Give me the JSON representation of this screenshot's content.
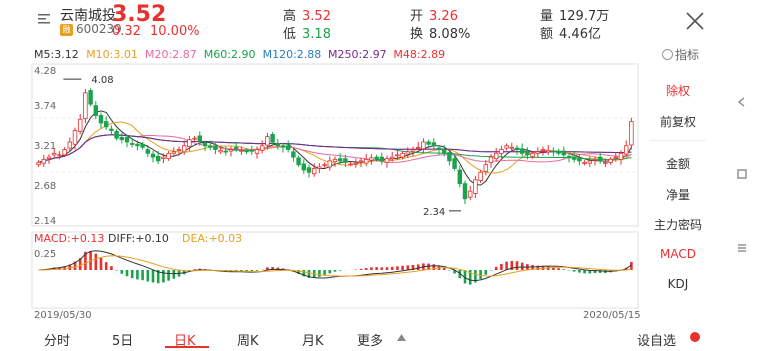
{
  "header": {
    "stock_name": "云南城投",
    "tag": "融",
    "code": "600239",
    "price": "3.52",
    "change": "0.32",
    "change_pct": "10.00%",
    "high_label": "高",
    "high_value": "3.52",
    "low_label": "低",
    "low_value": "3.18",
    "open_label": "开",
    "open_value": "3.26",
    "turnover_label": "换",
    "turnover_value": "8.08%",
    "volume_label": "量",
    "volume_value": "129.7万",
    "amount_label": "额",
    "amount_value": "4.46亿"
  },
  "indicator_link": "指标",
  "ma_legend": [
    {
      "label": "M5:3.12",
      "color": "#333333"
    },
    {
      "label": "M10:3.01",
      "color": "#e8a020"
    },
    {
      "label": "M20:2.87",
      "color": "#e86aa0"
    },
    {
      "label": "M60:2.90",
      "color": "#1aa34a"
    },
    {
      "label": "M120:2.88",
      "color": "#2a7fc0"
    },
    {
      "label": "M250:2.97",
      "color": "#7a2a8a"
    },
    {
      "label": "M48:2.89",
      "color": "#e8312f"
    }
  ],
  "chart_data": {
    "type": "candlestick",
    "y_ticks": [
      "4.28",
      "3.74",
      "3.21",
      "2.68",
      "2.14"
    ],
    "ylim": [
      2.14,
      4.28
    ],
    "annotations": [
      {
        "label": "4.08",
        "value": 4.08
      },
      {
        "label": "2.34",
        "value": 2.34
      }
    ],
    "macd_legend": [
      {
        "label": "MACD:+0.13",
        "color": "#e8312f"
      },
      {
        "label": "DIFF:+0.10",
        "color": "#333333"
      },
      {
        "label": "DEA:+0.03",
        "color": "#e8a020"
      }
    ],
    "macd_tick": "0.25",
    "x_start": "2019/05/30",
    "x_end": "2020/05/15",
    "closes": [
      2.98,
      3.02,
      3.05,
      3.1,
      3.08,
      3.15,
      3.25,
      3.4,
      3.55,
      3.9,
      3.75,
      3.6,
      3.5,
      3.45,
      3.4,
      3.3,
      3.28,
      3.25,
      3.22,
      3.2,
      3.18,
      3.1,
      3.05,
      3.0,
      3.05,
      3.1,
      3.12,
      3.15,
      3.2,
      3.28,
      3.3,
      3.25,
      3.2,
      3.18,
      3.15,
      3.14,
      3.12,
      3.15,
      3.16,
      3.14,
      3.12,
      3.13,
      3.15,
      3.2,
      3.32,
      3.25,
      3.2,
      3.18,
      3.15,
      3.05,
      2.95,
      2.88,
      2.85,
      2.9,
      2.92,
      2.95,
      3.0,
      3.02,
      3.0,
      2.98,
      2.96,
      2.97,
      3.0,
      3.02,
      3.04,
      3.02,
      3.0,
      3.03,
      3.05,
      3.08,
      3.1,
      3.12,
      3.15,
      3.18,
      3.25,
      3.22,
      3.2,
      3.15,
      3.1,
      3.0,
      2.9,
      2.7,
      2.5,
      2.6,
      2.75,
      2.85,
      2.95,
      3.05,
      3.1,
      3.15,
      3.2,
      3.18,
      3.15,
      3.1,
      3.08,
      3.1,
      3.12,
      3.15,
      3.14,
      3.12,
      3.1,
      3.08,
      3.05,
      3.02,
      3.0,
      2.98,
      3.0,
      3.02,
      3.0,
      2.98,
      3.02,
      3.05,
      3.1,
      3.2,
      3.52
    ]
  },
  "right_panel": {
    "items": [
      "除权",
      "前复权",
      "金额",
      "净量",
      "主力密码",
      "MACD",
      "KDJ"
    ]
  },
  "tabs": [
    "分时",
    "5日",
    "日K",
    "周K",
    "月K",
    "更多"
  ],
  "self_select": "设自选",
  "colors": {
    "up": "#e8312f",
    "down": "#1aa34a",
    "accent": "#e8312f"
  }
}
